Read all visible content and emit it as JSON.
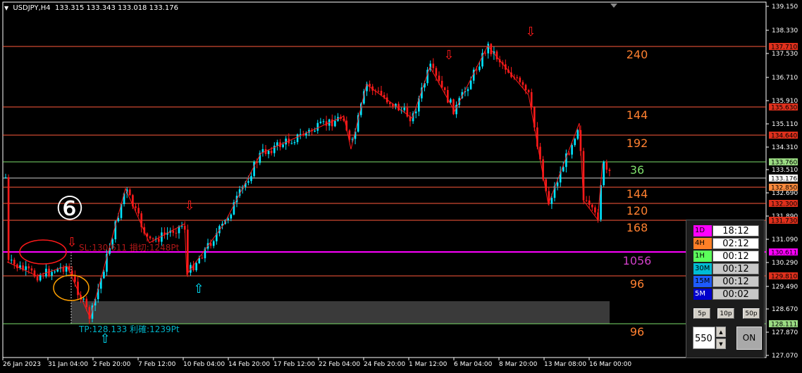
{
  "title": {
    "symbol": "USDJPY,H4",
    "ohlc": "133.315 133.343 133.018 133.176"
  },
  "colors": {
    "bull": "#00e5ff",
    "bear": "#ff1a1a",
    "level_line": "#ff5a3c",
    "green_line": "#7dde6b",
    "magenta": "#ff00ff",
    "orange_text": "#ff8030",
    "axis": "#ffffff",
    "tick_box_red": "#e0301c",
    "tick_box_orange": "#ff8a3c",
    "tick_box_green": "#9bdc83"
  },
  "price_axis": [
    "139.150",
    "138.330",
    "137.530",
    "136.710",
    "135.910",
    "135.110",
    "134.310",
    "133.510",
    "132.690",
    "131.890",
    "131.090",
    "130.290",
    "129.490",
    "128.670",
    "127.870",
    "127.070"
  ],
  "price_tags": {
    "l137710": "137.710",
    "l135630": "135.630",
    "l134640": "134.640",
    "l133760": "133.760",
    "l133176": "133.176",
    "l132850": "132.850",
    "l132300": "132.300",
    "l131730": "131.730",
    "l130611": "130.611",
    "l129810": "129.810",
    "l128111": "128.111"
  },
  "time_axis": [
    "26 Jan 2023",
    "31 Jan 04:00",
    "2 Feb 20:00",
    "7 Feb 12:00",
    "10 Feb 04:00",
    "14 Feb 20:00",
    "17 Feb 12:00",
    "22 Feb 04:00",
    "24 Feb 20:00",
    "1 Mar 12:00",
    "6 Mar 04:00",
    "8 Mar 20:00",
    "13 Mar 08:00",
    "16 Mar 00:00"
  ],
  "level_labels": {
    "n240": "240",
    "n144a": "144",
    "n192": "192",
    "n36": "36",
    "n144b": "144",
    "n120": "120",
    "n168": "168",
    "n1056": "1056",
    "n96a": "96",
    "n96b": "96"
  },
  "annotations": {
    "circled_number": "⑥",
    "sl_text": "SL:130.611 損切:1248Pt",
    "tp_text": "TP:128.133 利確:1239Pt",
    "down_arrow": "⇩",
    "up_arrow": "⇧"
  },
  "timer_panel": {
    "rows": [
      {
        "label": "1D",
        "value": "18:12",
        "color": "#ff00ff",
        "text": "#000000"
      },
      {
        "label": "4H",
        "value": "02:12",
        "color": "#ff7f27",
        "text": "#000000"
      },
      {
        "label": "1H",
        "value": "00:12",
        "color": "#5bff5b",
        "text": "#000000"
      },
      {
        "label": "30M",
        "value": "00:12",
        "color": "#00bcd4",
        "text": "#000000"
      },
      {
        "label": "15M",
        "value": "00:12",
        "color": "#1e5bff",
        "text": "#000000"
      },
      {
        "label": "5M",
        "value": "00:02",
        "color": "#0000cc",
        "text": "#ffffff"
      }
    ],
    "buttons": [
      "5p",
      "10p",
      "50p"
    ],
    "input_value": "550",
    "on_label": "ON"
  }
}
